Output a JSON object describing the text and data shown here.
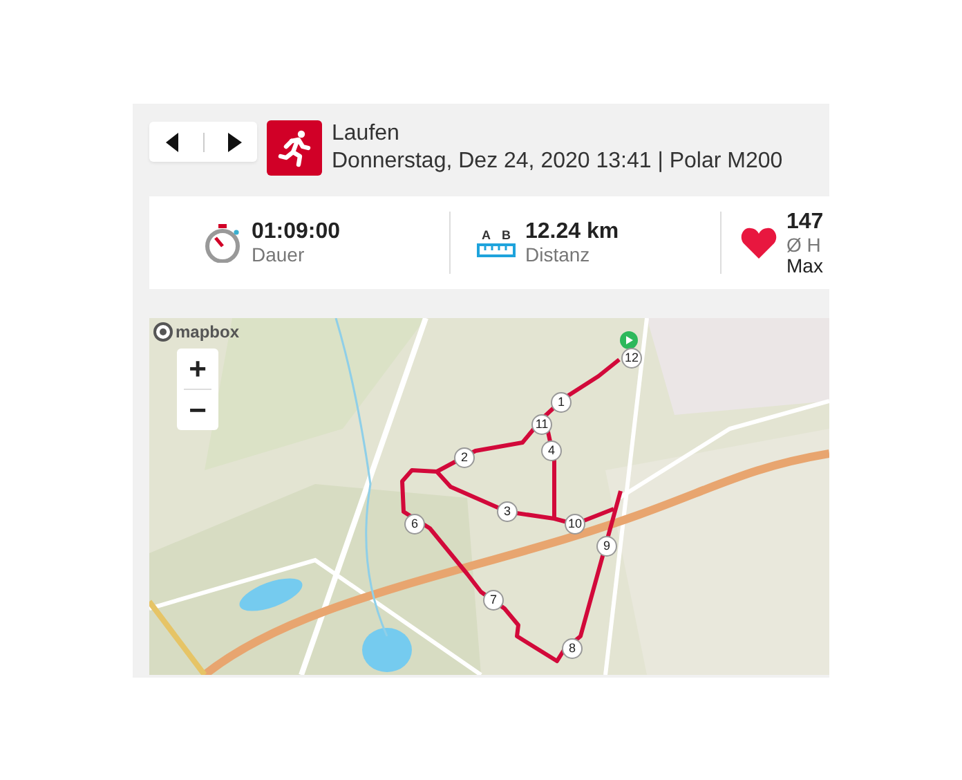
{
  "header": {
    "activity": "Laufen",
    "subtitle": "Donnerstag, Dez 24, 2020 13:41 | Polar M200"
  },
  "stats": [
    {
      "kind": "duration",
      "value": "01:09:00",
      "label": "Dauer"
    },
    {
      "kind": "distance",
      "icon_labels": [
        "A",
        "B"
      ],
      "value": "12.24 km",
      "label": "Distanz"
    },
    {
      "kind": "heart",
      "value": "147",
      "label": "Ø H",
      "extra": "Max"
    }
  ],
  "map": {
    "logo": "mapbox",
    "zoom_in": "+",
    "zoom_out": "−",
    "markers": [
      "1",
      "2",
      "3",
      "4",
      "6",
      "7",
      "8",
      "9",
      "10",
      "11",
      "12"
    ]
  }
}
